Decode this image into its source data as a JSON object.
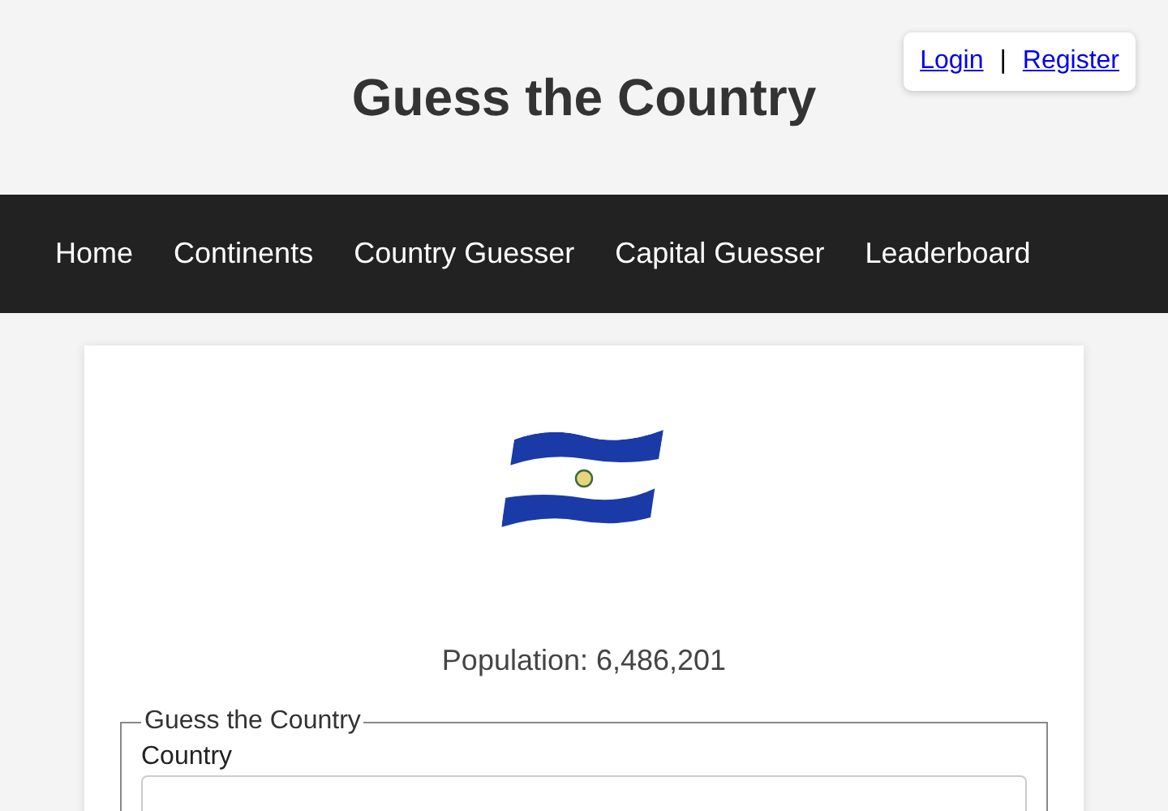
{
  "header": {
    "title": "Guess the Country",
    "auth_links": [
      {
        "label": "Login"
      },
      {
        "label": "Register"
      }
    ],
    "separator": "|"
  },
  "nav": {
    "items": [
      {
        "label": "Home"
      },
      {
        "label": "Continents"
      },
      {
        "label": "Country Guesser"
      },
      {
        "label": "Capital Guesser"
      },
      {
        "label": "Leaderboard"
      }
    ]
  },
  "card": {
    "population": "Population: 6,486,201",
    "form": {
      "legend": "Guess the Country",
      "field_label": "Country"
    }
  }
}
